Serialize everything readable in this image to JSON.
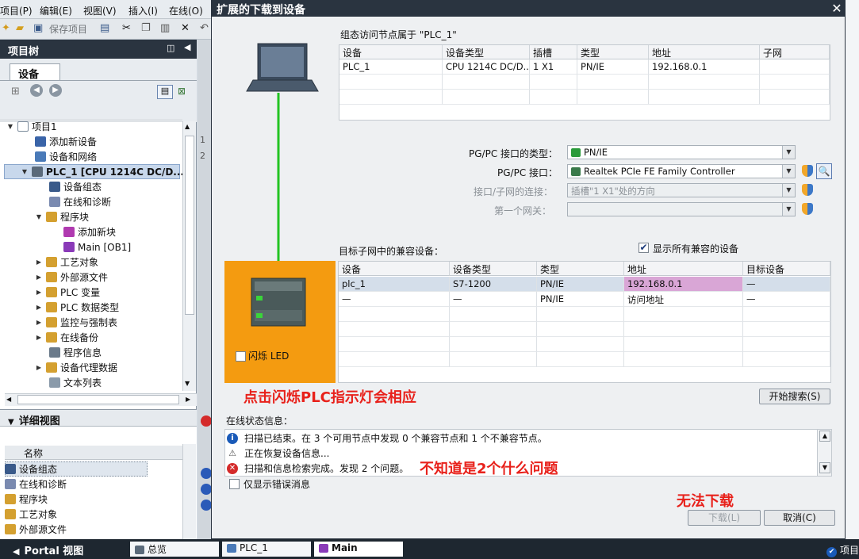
{
  "menubar": {
    "items": [
      "项目(P)",
      "编辑(E)",
      "视图(V)",
      "插入(I)",
      "在线(O)"
    ]
  },
  "toolbar": {
    "save_project": "保存项目"
  },
  "project_tree": {
    "title": "项目树",
    "tab_devices": "设备",
    "items": [
      {
        "label": "项目1"
      },
      {
        "label": "添加新设备"
      },
      {
        "label": "设备和网络"
      },
      {
        "label": "PLC_1 [CPU 1214C DC/D..."
      },
      {
        "label": "设备组态"
      },
      {
        "label": "在线和诊断"
      },
      {
        "label": "程序块"
      },
      {
        "label": "添加新块"
      },
      {
        "label": "Main [OB1]"
      },
      {
        "label": "工艺对象"
      },
      {
        "label": "外部源文件"
      },
      {
        "label": "PLC 变量"
      },
      {
        "label": "PLC 数据类型"
      },
      {
        "label": "监控与强制表"
      },
      {
        "label": "在线备份"
      },
      {
        "label": "程序信息"
      },
      {
        "label": "设备代理数据"
      },
      {
        "label": "文本列表"
      }
    ]
  },
  "detail_view": {
    "title": "详细视图",
    "column_name": "名称",
    "items": [
      "设备组态",
      "在线和诊断",
      "程序块",
      "工艺对象",
      "外部源文件"
    ]
  },
  "dialog": {
    "title": "扩展的下载到设备",
    "config_header": "组态访问节点属于 \"PLC_1\"",
    "config_table": {
      "columns": [
        "设备",
        "设备类型",
        "插槽",
        "类型",
        "地址",
        "子网"
      ],
      "rows": [
        [
          "PLC_1",
          "CPU 1214C DC/D...",
          "1 X1",
          "PN/IE",
          "192.168.0.1",
          ""
        ]
      ]
    },
    "pgpc_type_label": "PG/PC 接口的类型：",
    "pgpc_type_value": "PN/IE",
    "pgpc_iface_label": "PG/PC 接口：",
    "pgpc_iface_value": "Realtek PCIe FE Family Controller",
    "subnet_conn_label": "接口/子网的连接：",
    "subnet_conn_value": "插槽\"1 X1\"处的方向",
    "first_gateway_label": "第一个网关：",
    "first_gateway_value": "",
    "target_label": "目标子网中的兼容设备：",
    "show_all_label": "显示所有兼容的设备",
    "target_table": {
      "columns": [
        "设备",
        "设备类型",
        "类型",
        "地址",
        "目标设备"
      ],
      "rows": [
        [
          "plc_1",
          "S7-1200",
          "PN/IE",
          "192.168.0.1",
          "—"
        ],
        [
          "—",
          "—",
          "PN/IE",
          "访问地址",
          "—"
        ]
      ]
    },
    "flash_led_label": "闪烁 LED",
    "start_search_button": "开始搜索(S)",
    "online_status_label": "在线状态信息：",
    "status_messages": [
      "扫描已结束。在 3 个可用节点中发现 0 个兼容节点和 1 个不兼容节点。",
      "正在恢复设备信息...",
      "扫描和信息检索完成。发现 2 个问题。"
    ],
    "show_errors_label": "仅显示错误消息",
    "download_button": "下载(L)",
    "cancel_button": "取消(C)"
  },
  "annotations": {
    "flash_note": "点击闪烁PLC指示灯会相应",
    "problem_note": "不知道是2个什么问题",
    "no_download_note": "无法下载"
  },
  "statusbar": {
    "portal_view": "Portal 视图",
    "tabs": [
      "总览",
      "PLC_1",
      "Main"
    ],
    "right_label": "项目"
  },
  "colors": {
    "title_bar": "#2a3440",
    "orange_panel": "#f49b10",
    "annotation_red": "#e8211b",
    "address_highlight": "#d9a6d6"
  }
}
